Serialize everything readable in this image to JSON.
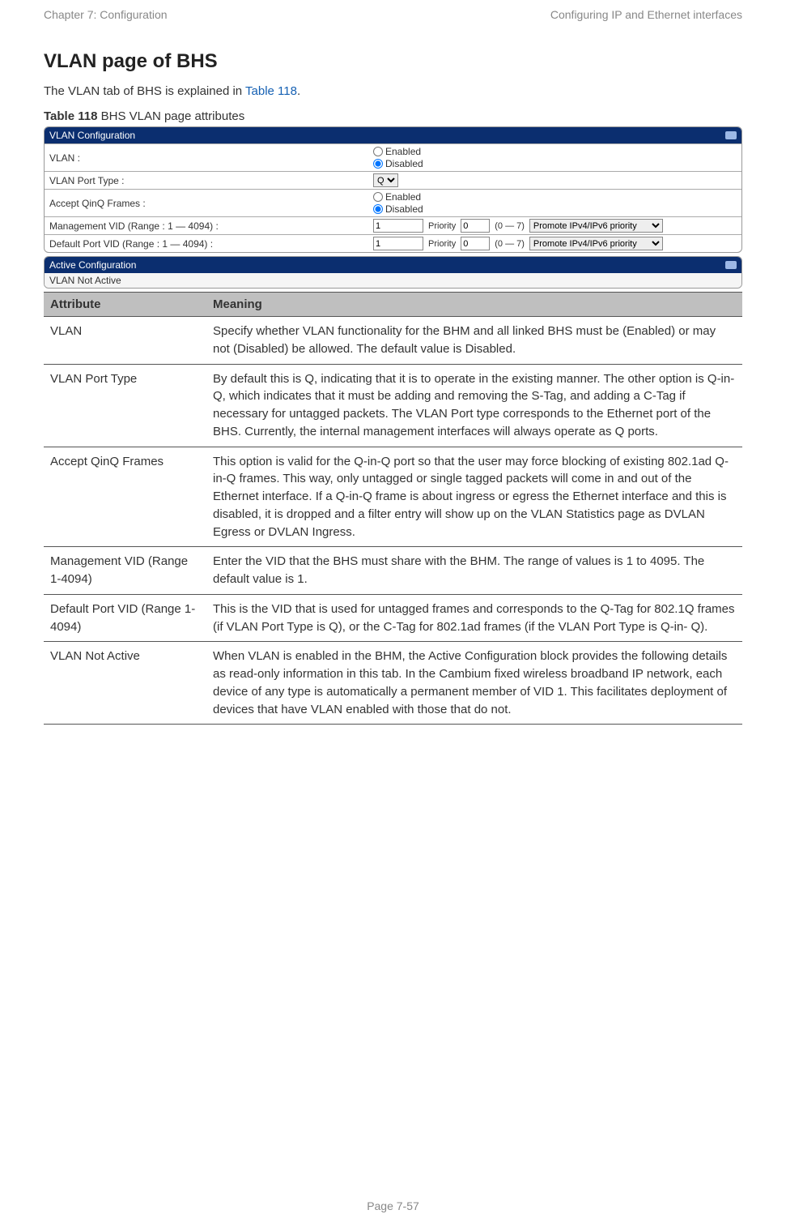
{
  "header": {
    "left": "Chapter 7:  Configuration",
    "right": "Configuring IP and Ethernet interfaces"
  },
  "title": "VLAN page of BHS",
  "intro": {
    "prefix": "The VLAN tab of BHS is explained in ",
    "link": "Table 118",
    "suffix": "."
  },
  "caption": {
    "bold": "Table 118",
    "rest": " BHS VLAN page attributes"
  },
  "form": {
    "sections": {
      "vlan_config_title": "VLAN Configuration",
      "active_config_title": "Active Configuration"
    },
    "rows": {
      "vlan_label": "VLAN :",
      "vlan_opts": {
        "enabled": "Enabled",
        "disabled": "Disabled"
      },
      "port_type_label": "VLAN Port Type :",
      "port_type_value": "Q",
      "accept_qinq_label": "Accept QinQ Frames :",
      "mgmt_vid_label": "Management VID (Range : 1 — 4094) :",
      "default_vid_label": "Default Port VID (Range : 1 — 4094) :",
      "vid_value": "1",
      "priority_label": "Priority",
      "priority_value": "0",
      "range_text": "(0 — 7)",
      "promote_text": "Promote IPv4/IPv6 priority"
    },
    "active_body": "VLAN Not Active"
  },
  "table": {
    "headers": {
      "attr": "Attribute",
      "meaning": "Meaning"
    },
    "rows": [
      {
        "attr": "VLAN",
        "meaning": "Specify whether VLAN functionality for the BHM and all linked BHS must be (Enabled) or may not (Disabled) be allowed. The default value is Disabled."
      },
      {
        "attr": "VLAN Port Type",
        "meaning": "By default this is Q, indicating that it is to operate in the existing manner. The other option is Q-in-Q, which indicates that it must be adding and removing the S-Tag, and adding a C-Tag if necessary for untagged packets. The VLAN Port type corresponds to the Ethernet port of the BHS. Currently, the internal management interfaces will always operate as Q ports."
      },
      {
        "attr": "Accept QinQ Frames",
        "meaning": "This option is valid for the Q-in-Q port so that the user may force blocking of existing 802.1ad Q-in-Q frames. This way, only untagged or single tagged packets will come in and out of the Ethernet interface. If a Q-in-Q frame is about ingress or egress the Ethernet interface and this is disabled, it is dropped and a filter entry will show up on the VLAN Statistics page as DVLAN Egress or DVLAN Ingress."
      },
      {
        "attr": "Management VID (Range 1-4094)",
        "meaning": "Enter the VID that the BHS must share with the BHM. The range of values is 1 to 4095. The default value is 1."
      },
      {
        "attr": "Default Port VID (Range 1-4094)",
        "meaning": "This is the VID that is used for untagged frames and corresponds to the Q-Tag for 802.1Q frames (if VLAN Port Type is Q), or the C-Tag for 802.1ad frames (if the VLAN Port Type is Q-in- Q)."
      },
      {
        "attr": "VLAN Not Active",
        "meaning": "When VLAN is enabled in the BHM, the Active Configuration block provides the following details as read-only information in this tab. In the Cambium fixed wireless broadband IP network, each device of any type is automatically a permanent member of VID 1. This facilitates deployment of devices that have VLAN enabled with those that do not."
      }
    ]
  },
  "footer": "Page 7-57"
}
